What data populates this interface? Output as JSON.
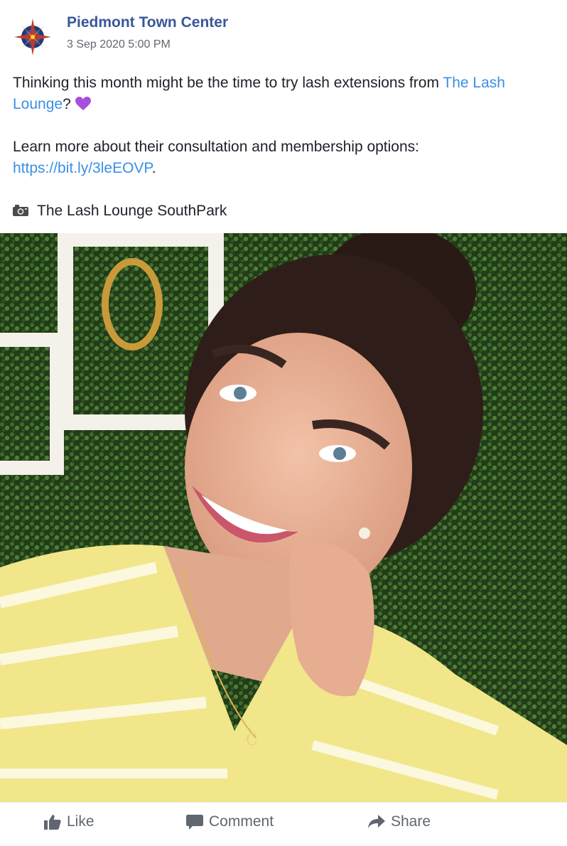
{
  "post": {
    "page_name": "Piedmont Town Center",
    "timestamp": "3 Sep 2020 5:00 PM",
    "text": {
      "line1_prefix": "Thinking this month might be the time to try lash extensions from ",
      "mention": "The Lash Lounge",
      "line1_suffix": "?",
      "learn_more": "Learn more about their consultation and membership options:",
      "url": "https://bit.ly/3leEOVP",
      "url_suffix": ".",
      "location": "The Lash Lounge SouthPark"
    },
    "icons": {
      "avatar": "compass-logo-icon",
      "heart": "purple-heart-icon",
      "camera": "camera-icon"
    }
  },
  "actions": {
    "like": "Like",
    "comment": "Comment",
    "share": "Share"
  },
  "colors": {
    "page_name": "#385898",
    "link": "#3b8fe5",
    "heart": "#a84fdc",
    "action_text": "#606770"
  }
}
